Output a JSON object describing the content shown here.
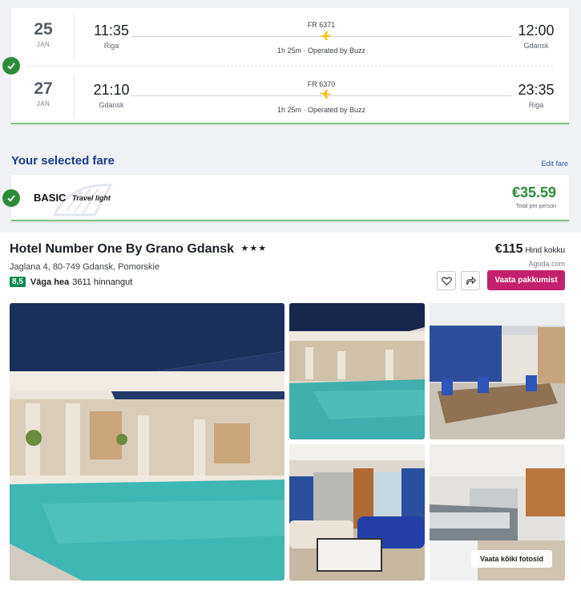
{
  "flights": [
    {
      "day": "25",
      "month": "JAN",
      "dep_time": "11:35",
      "dep_city": "Riga",
      "flight_no": "FR 6371",
      "duration": "1h 25m · Operated by Buzz",
      "arr_time": "12:00",
      "arr_city": "Gdansk"
    },
    {
      "day": "27",
      "month": "JAN",
      "dep_time": "21:10",
      "dep_city": "Gdansk",
      "flight_no": "FR 6370",
      "duration": "1h 25m · Operated by Buzz",
      "arr_time": "23:35",
      "arr_city": "Riga"
    }
  ],
  "fare": {
    "title": "Your selected fare",
    "edit_label": "Edit fare",
    "name": "BASIC",
    "subtitle": "Travel light",
    "price": "€35.59",
    "price_note": "Total per person"
  },
  "hotel": {
    "name": "Hotel Number One By Grano Gdansk",
    "stars": "★★★",
    "address": "Jaglana 4, 80-749 Gdansk, Pomorskie",
    "rating": "8,5",
    "rating_word": "Väga hea",
    "reviews": "3611 hinnangut",
    "price": "€115",
    "price_note": "Hind kokku",
    "provider": "Agoda.com",
    "deal_label": "Vaata pakkumist",
    "see_all_label": "Vaata kõiki fotosid"
  },
  "colors": {
    "accent_blue": "#1a3c8c",
    "check_green": "#2e8b3a",
    "price_green": "#2e8b3a",
    "deal_magenta": "#c4216c",
    "rating_green": "#108a4f",
    "plane_yellow": "#f2c200"
  },
  "icons": {
    "check": "check-icon",
    "plane": "plane-icon",
    "favorite": "heart-icon",
    "share": "share-icon"
  }
}
